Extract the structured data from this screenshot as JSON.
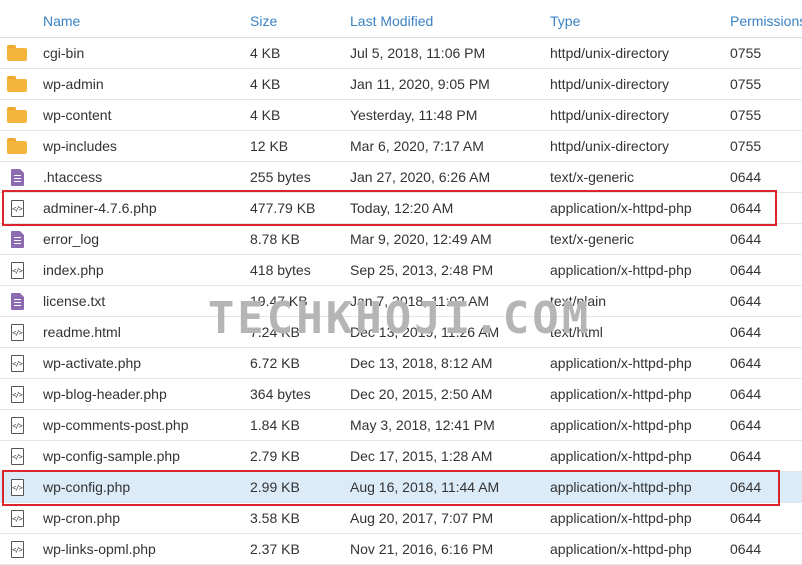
{
  "columns": {
    "name": "Name",
    "size": "Size",
    "modified": "Last Modified",
    "type": "Type",
    "permissions": "Permissions"
  },
  "files": [
    {
      "icon": "folder-icon",
      "name": "cgi-bin",
      "size": "4 KB",
      "modified": "Jul 5, 2018, 11:06 PM",
      "type": "httpd/unix-directory",
      "perm": "0755"
    },
    {
      "icon": "folder-icon",
      "name": "wp-admin",
      "size": "4 KB",
      "modified": "Jan 11, 2020, 9:05 PM",
      "type": "httpd/unix-directory",
      "perm": "0755"
    },
    {
      "icon": "folder-icon",
      "name": "wp-content",
      "size": "4 KB",
      "modified": "Yesterday, 11:48 PM",
      "type": "httpd/unix-directory",
      "perm": "0755"
    },
    {
      "icon": "folder-icon",
      "name": "wp-includes",
      "size": "12 KB",
      "modified": "Mar 6, 2020, 7:17 AM",
      "type": "httpd/unix-directory",
      "perm": "0755"
    },
    {
      "icon": "text-file-icon",
      "name": ".htaccess",
      "size": "255 bytes",
      "modified": "Jan 27, 2020, 6:26 AM",
      "type": "text/x-generic",
      "perm": "0644"
    },
    {
      "icon": "code-file-icon",
      "name": "adminer-4.7.6.php",
      "size": "477.79 KB",
      "modified": "Today, 12:20 AM",
      "type": "application/x-httpd-php",
      "perm": "0644"
    },
    {
      "icon": "text-file-icon",
      "name": "error_log",
      "size": "8.78 KB",
      "modified": "Mar 9, 2020, 12:49 AM",
      "type": "text/x-generic",
      "perm": "0644"
    },
    {
      "icon": "code-file-icon",
      "name": "index.php",
      "size": "418 bytes",
      "modified": "Sep 25, 2013, 2:48 PM",
      "type": "application/x-httpd-php",
      "perm": "0644"
    },
    {
      "icon": "text-file-icon",
      "name": "license.txt",
      "size": "19.47 KB",
      "modified": "Jan 7, 2018, 11:02 AM",
      "type": "text/plain",
      "perm": "0644"
    },
    {
      "icon": "code-file-icon",
      "name": "readme.html",
      "size": "7.24 KB",
      "modified": "Dec 13, 2019, 11:26 AM",
      "type": "text/html",
      "perm": "0644"
    },
    {
      "icon": "code-file-icon",
      "name": "wp-activate.php",
      "size": "6.72 KB",
      "modified": "Dec 13, 2018, 8:12 AM",
      "type": "application/x-httpd-php",
      "perm": "0644"
    },
    {
      "icon": "code-file-icon",
      "name": "wp-blog-header.php",
      "size": "364 bytes",
      "modified": "Dec 20, 2015, 2:50 AM",
      "type": "application/x-httpd-php",
      "perm": "0644"
    },
    {
      "icon": "code-file-icon",
      "name": "wp-comments-post.php",
      "size": "1.84 KB",
      "modified": "May 3, 2018, 12:41 PM",
      "type": "application/x-httpd-php",
      "perm": "0644"
    },
    {
      "icon": "code-file-icon",
      "name": "wp-config-sample.php",
      "size": "2.79 KB",
      "modified": "Dec 17, 2015, 1:28 AM",
      "type": "application/x-httpd-php",
      "perm": "0644"
    },
    {
      "icon": "code-file-icon",
      "name": "wp-config.php",
      "size": "2.99 KB",
      "modified": "Aug 16, 2018, 11:44 AM",
      "type": "application/x-httpd-php",
      "perm": "0644",
      "selected": true
    },
    {
      "icon": "code-file-icon",
      "name": "wp-cron.php",
      "size": "3.58 KB",
      "modified": "Aug 20, 2017, 7:07 PM",
      "type": "application/x-httpd-php",
      "perm": "0644"
    },
    {
      "icon": "code-file-icon",
      "name": "wp-links-opml.php",
      "size": "2.37 KB",
      "modified": "Nov 21, 2016, 6:16 PM",
      "type": "application/x-httpd-php",
      "perm": "0644"
    }
  ],
  "watermark": "TECHKHOJI.COM",
  "colors": {
    "header_text": "#3a82c4",
    "highlight_border": "#d9252b",
    "selected_row": "#dcebf8",
    "folder": "#f5b53c",
    "text_file": "#8c6bb1"
  }
}
